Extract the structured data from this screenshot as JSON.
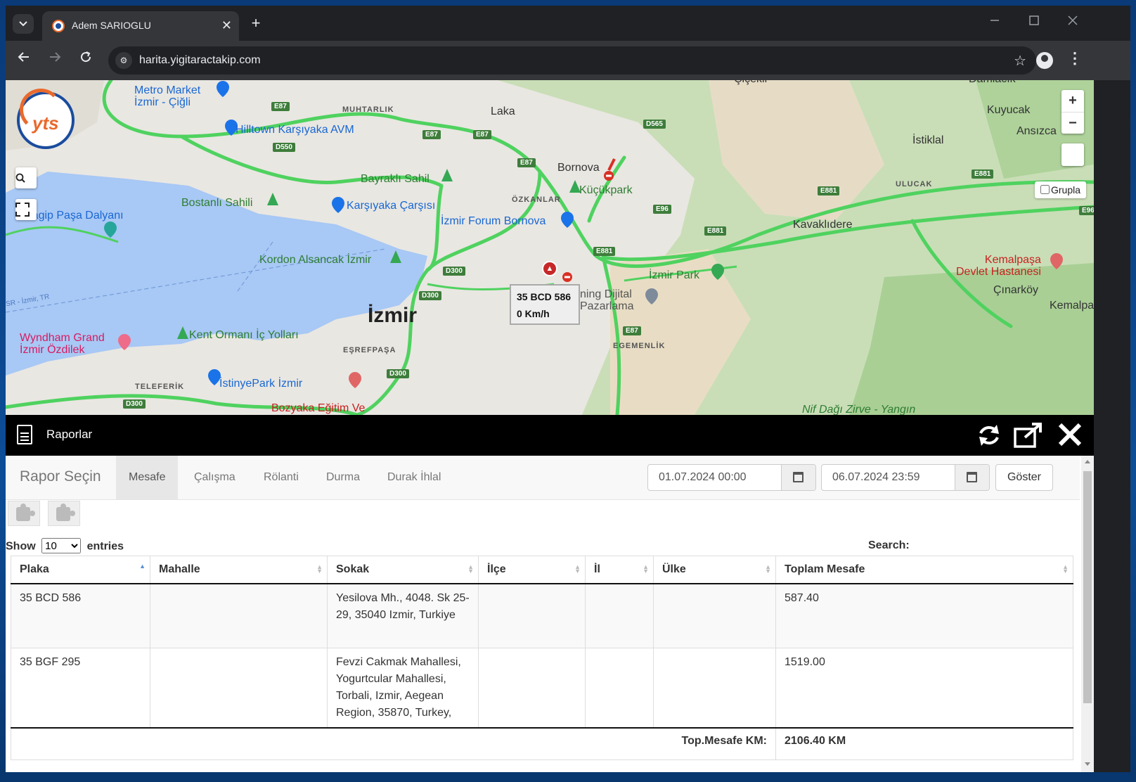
{
  "browser": {
    "tab_title": "Adem SARIOGLU",
    "url": "harita.yigitaractakip.com",
    "new_tab_symbol": "+",
    "tab_close_symbol": "✕"
  },
  "map": {
    "labels": {
      "metro_market": "Metro Market\nİzmir - Çiğli",
      "muhtarlik": "MUHTARLIK",
      "laka": "Laka",
      "cicekli": "Çiçekli",
      "damlacik": "Damlacık",
      "kuyucak": "Kuyucak",
      "ansizca": "Ansızca",
      "istiklal": "İstiklal",
      "hilltown": "Hilltown Karşıyaka AVM",
      "bornova": "Bornova",
      "kucukpark": "Küçükpark",
      "bayrakli_sahil": "Bayraklı Sahil",
      "ozkanlar": "ÖZKANLAR",
      "ulucak": "ULUCAK",
      "bostanli_sahili": "Bostanlı Sahili",
      "karsiyaka_carsisi": "Karşıyaka Çarşısı",
      "kagip": "Kagip Paşa Dalyanı",
      "forum_bornova": "İzmir Forum Bornova",
      "kavaklidere": "Kavaklıdere",
      "kordon": "Kordon Alsancak İzmir",
      "izmir_park": "İzmir Park",
      "kemalpasa_devlet": "Kemalpaşa\nDevlet Hastanesi",
      "cinarkoy": "Çınarköy",
      "kemalpasa": "Kemalpa",
      "izmir": "İzmir",
      "dijital": "ning Dijital\nPazarlama",
      "sr_izmir": "SR - İzmir, TR",
      "wyndham": "Wyndham Grand\nİzmir Özdilek",
      "kent_ormani": "Kent Ormanı İç Yolları",
      "esrefpasa": "EŞREFPAŞA",
      "egemenlik": "EGEMENLİK",
      "teleferik": "TELEFERİK",
      "istinyepark": "İstinyePark İzmir",
      "bozyaka": "Bozyaka Eğitim Ve",
      "nif_dagi": "Nif Dağı Zirve - Yangın"
    },
    "roads": [
      "E87",
      "E87",
      "E87",
      "E87",
      "E87",
      "D565",
      "D550",
      "E881",
      "E881",
      "E881",
      "E881",
      "E96",
      "E96",
      "D300",
      "D300",
      "D300",
      "D300"
    ],
    "vehicle": {
      "plate": "35 BCD 586",
      "speed": "0 Km/h"
    },
    "zoom_in": "+",
    "zoom_out": "−",
    "grupla_label": "Grupla",
    "logo_text": "yts"
  },
  "panel": {
    "title": "Raporlar",
    "rapor_secin": "Rapor Seçin",
    "tabs": [
      "Mesafe",
      "Çalışma",
      "Rölanti",
      "Durma",
      "Durak İhlal"
    ],
    "active_tab": "Mesafe",
    "date_from": "01.07.2024 00:00",
    "date_to": "06.07.2024 23:59",
    "show_button": "Göster",
    "show_label": "Show",
    "entries_label": "entries",
    "entries_value": "10",
    "search_label": "Search:",
    "columns": [
      "Plaka",
      "Mahalle",
      "Sokak",
      "İlçe",
      "İl",
      "Ülke",
      "Toplam Mesafe"
    ],
    "rows": [
      {
        "plaka": "35 BCD 586",
        "mahalle": "",
        "sokak": "Yesilova Mh., 4048. Sk 25-29, 35040 Izmir, Turkiye",
        "ilce": "",
        "il": "",
        "ulke": "",
        "toplam": "587.40"
      },
      {
        "plaka": "35 BGF 295",
        "mahalle": "",
        "sokak": "Fevzi Cakmak Mahallesi, Yogurtcular Mahallesi, Torbali, Izmir, Aegean Region, 35870, Turkey,",
        "ilce": "",
        "il": "",
        "ulke": "",
        "toplam": "1519.00"
      }
    ],
    "footer_label": "Top.Mesafe KM:",
    "footer_value": "2106.40 KM"
  },
  "colors": {
    "road_green": "#4fd25f",
    "water": "#a8c8f5",
    "forest": "#b9d9a4",
    "urban": "#e9e7e2",
    "panel_header": "#000000"
  }
}
